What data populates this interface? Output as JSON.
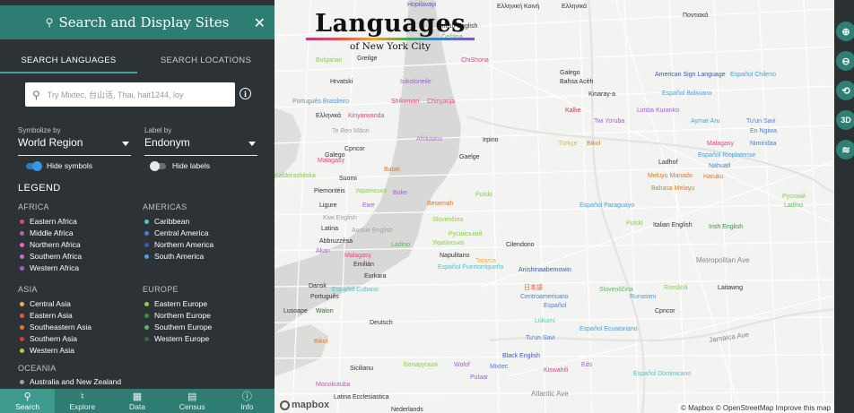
{
  "panel": {
    "title": "Search and Display Sites",
    "tabs": [
      {
        "label": "SEARCH LANGUAGES"
      },
      {
        "label": "SEARCH LOCATIONS"
      }
    ],
    "search": {
      "placeholder": "Try Mixtec, 台山话, Thai, hait1244, loy"
    },
    "symbolize": {
      "label": "Symbolize by",
      "value": "World Region"
    },
    "label_by": {
      "label": "Label by",
      "value": "Endonym"
    },
    "toggles": {
      "hide_symbols": "Hide symbols",
      "hide_labels": "Hide labels"
    },
    "legend": {
      "title": "LEGEND",
      "groups": [
        {
          "region": "AFRICA",
          "items": [
            {
              "label": "Eastern Africa",
              "color": "#e8437f"
            },
            {
              "label": "Middle Africa",
              "color": "#b85fb3"
            },
            {
              "label": "Northern Africa",
              "color": "#e86bb3"
            },
            {
              "label": "Southern Africa",
              "color": "#c06fd6"
            },
            {
              "label": "Western Africa",
              "color": "#a45ed9"
            }
          ]
        },
        {
          "region": "AMERICAS",
          "items": [
            {
              "label": "Caribbean",
              "color": "#4fc3c6"
            },
            {
              "label": "Central America",
              "color": "#4b7fd6"
            },
            {
              "label": "Northern America",
              "color": "#3959b7"
            },
            {
              "label": "South America",
              "color": "#4aa0e0"
            }
          ]
        },
        {
          "region": "ASIA",
          "items": [
            {
              "label": "Central Asia",
              "color": "#f0b33f"
            },
            {
              "label": "Eastern Asia",
              "color": "#e85a3d"
            },
            {
              "label": "Southeastern Asia",
              "color": "#e07a2a"
            },
            {
              "label": "Southern Asia",
              "color": "#d93a3a"
            },
            {
              "label": "Western Asia",
              "color": "#c9c24a"
            }
          ]
        },
        {
          "region": "EUROPE",
          "items": [
            {
              "label": "Eastern Europe",
              "color": "#88d04b"
            },
            {
              "label": "Northern Europe",
              "color": "#3d8f3d"
            },
            {
              "label": "Southern Europe",
              "color": "#5cb85c"
            },
            {
              "label": "Western Europe",
              "color": "#2f6e2f"
            }
          ]
        },
        {
          "region": "OCEANIA",
          "items": [
            {
              "label": "Australia and New Zealand",
              "color": "#9aa3a6"
            }
          ]
        }
      ]
    },
    "nav": [
      {
        "label": "Search",
        "icon": "search-icon"
      },
      {
        "label": "Explore",
        "icon": "binoculars-icon"
      },
      {
        "label": "Data",
        "icon": "table-icon"
      },
      {
        "label": "Census",
        "icon": "clipboard-icon"
      },
      {
        "label": "Info",
        "icon": "info-icon"
      }
    ]
  },
  "map": {
    "title": "Languages",
    "subtitle": "of New York City",
    "logo": "mapbox",
    "attribution": "© Mapbox © OpenStreetMap Improve this map",
    "streets": [
      "Metropolitan Ave",
      "Jamaica Ave",
      "Atlantic Ave"
    ],
    "labels": [
      {
        "text": "Hopilavayi",
        "color": "#6a4fb3"
      },
      {
        "text": "Ελληνική Κοινή",
        "color": "#333"
      },
      {
        "text": "British English",
        "color": "#333"
      },
      {
        "text": "Čeština",
        "color": "#5cb85c"
      },
      {
        "text": "Ποντιακά",
        "color": "#333"
      },
      {
        "text": "Ελληνικά",
        "color": "#333"
      },
      {
        "text": "Greilge",
        "color": "#333"
      },
      {
        "text": "Bulgarian",
        "color": "#88d04b"
      },
      {
        "text": "ChiShona",
        "color": "#e8437f"
      },
      {
        "text": "Galego",
        "color": "#333"
      },
      {
        "text": "American Sign Language",
        "color": "#3959b7"
      },
      {
        "text": "Español Chileno",
        "color": "#4aa0e0"
      },
      {
        "text": "Hrvatski",
        "color": "#333"
      },
      {
        "text": "Isikoloneile",
        "color": "#a45ed9"
      },
      {
        "text": "Bahsa Acèh",
        "color": "#333"
      },
      {
        "text": "Kinaray-a",
        "color": "#333"
      },
      {
        "text": "Español Boliviano",
        "color": "#4aa0e0"
      },
      {
        "text": "Português Brasileiro",
        "color": "#4aa0e0"
      },
      {
        "text": "Shikomori",
        "color": "#e8437f"
      },
      {
        "text": "Chinyanja",
        "color": "#e8437f"
      },
      {
        "text": "Limba Kuranko",
        "color": "#a45ed9"
      },
      {
        "text": "Kalke",
        "color": "#d93a3a"
      },
      {
        "text": "Ελληνικά",
        "color": "#333"
      },
      {
        "text": "Kinyarwanda",
        "color": "#e8437f"
      },
      {
        "text": "Twi Yoruba",
        "color": "#a45ed9"
      },
      {
        "text": "Aymar Aru",
        "color": "#4aa0e0"
      },
      {
        "text": "Tu'un Savi",
        "color": "#4b7fd6"
      },
      {
        "text": "En Ngiwa",
        "color": "#4b7fd6"
      },
      {
        "text": "Te Reo Māori",
        "color": "#9aa3a6"
      },
      {
        "text": "Afrikaans",
        "color": "#c06fd6"
      },
      {
        "text": "Irpino",
        "color": "#333"
      },
      {
        "text": "Türkçe",
        "color": "#c9c24a"
      },
      {
        "text": "Bikol",
        "color": "#e07a2a"
      },
      {
        "text": "Malagasy",
        "color": "#e8437f"
      },
      {
        "text": "Nimiridaa",
        "color": "#4b7fd6"
      },
      {
        "text": "Cpncor",
        "color": "#333"
      },
      {
        "text": "Galego",
        "color": "#333"
      },
      {
        "text": "Gaelge",
        "color": "#333"
      },
      {
        "text": "Español Rioplatense",
        "color": "#4aa0e0"
      },
      {
        "text": "Malagasy",
        "color": "#e8437f"
      },
      {
        "text": "Ladhof",
        "color": "#333"
      },
      {
        "text": "Nahuatl",
        "color": "#4b7fd6"
      },
      {
        "text": "Batak",
        "color": "#e07a2a"
      },
      {
        "text": "Kalderashitska",
        "color": "#88d04b"
      },
      {
        "text": "Suomi",
        "color": "#333"
      },
      {
        "text": "Meluyu Manado",
        "color": "#e07a2a"
      },
      {
        "text": "Haruku",
        "color": "#e07a2a"
      },
      {
        "text": "Piemontèis",
        "color": "#333"
      },
      {
        "text": "Українська",
        "color": "#88d04b"
      },
      {
        "text": "Boke",
        "color": "#a45ed9"
      },
      {
        "text": "Polski",
        "color": "#88d04b"
      },
      {
        "text": "Bahasa Melayu",
        "color": "#e07a2a"
      },
      {
        "text": "Русский",
        "color": "#88d04b"
      },
      {
        "text": "Ligure",
        "color": "#333"
      },
      {
        "text": "Ewe",
        "color": "#a45ed9"
      },
      {
        "text": "Besemah",
        "color": "#e07a2a"
      },
      {
        "text": "Español Paraguayo",
        "color": "#4aa0e0"
      },
      {
        "text": "Ladino",
        "color": "#5cb85c"
      },
      {
        "text": "Kiwi English",
        "color": "#9aa3a6"
      },
      {
        "text": "Latina",
        "color": "#333"
      },
      {
        "text": "Slovenčina",
        "color": "#88d04b"
      },
      {
        "text": "Polski",
        "color": "#88d04b"
      },
      {
        "text": "Italian English",
        "color": "#333"
      },
      {
        "text": "Irish English",
        "color": "#3d8f3d"
      },
      {
        "text": "Aussie English",
        "color": "#9aa3a6"
      },
      {
        "text": "Русинський",
        "color": "#88d04b"
      },
      {
        "text": "Abbruzzèsa",
        "color": "#333"
      },
      {
        "text": "Ladino",
        "color": "#5cb85c"
      },
      {
        "text": "Українська",
        "color": "#88d04b"
      },
      {
        "text": "Cilendono",
        "color": "#333"
      },
      {
        "text": "Akan",
        "color": "#a45ed9"
      },
      {
        "text": "Malagasy",
        "color": "#e8437f"
      },
      {
        "text": "Napulitano",
        "color": "#333"
      },
      {
        "text": "Emilián",
        "color": "#333"
      },
      {
        "text": "Tatarca",
        "color": "#f0b33f"
      },
      {
        "text": "Español Puertorriqueño",
        "color": "#4fc3c6"
      },
      {
        "text": "Eurkara",
        "color": "#333"
      },
      {
        "text": "Anishinaabemowin",
        "color": "#3959b7"
      },
      {
        "text": "Dansk",
        "color": "#333"
      },
      {
        "text": "Español Cubano",
        "color": "#4fc3c6"
      },
      {
        "text": "日本語",
        "color": "#e85a3d"
      },
      {
        "text": "Slovenščina",
        "color": "#5cb85c"
      },
      {
        "text": "Română",
        "color": "#88d04b"
      },
      {
        "text": "Laitawng",
        "color": "#333"
      },
      {
        "text": "Português",
        "color": "#333"
      },
      {
        "text": "Centroamericano",
        "color": "#4b7fd6"
      },
      {
        "text": "Español",
        "color": "#4b7fd6"
      },
      {
        "text": "Runasimi",
        "color": "#4aa0e0"
      },
      {
        "text": "Cpncor",
        "color": "#333"
      },
      {
        "text": "Lusoape",
        "color": "#333"
      },
      {
        "text": "Walon",
        "color": "#2f6e2f"
      },
      {
        "text": "Deutsch",
        "color": "#333"
      },
      {
        "text": "Lùkumí",
        "color": "#4fc3c6"
      },
      {
        "text": "Español Ecuatoriano",
        "color": "#4aa0e0"
      },
      {
        "text": "Tu'un Savi",
        "color": "#4b7fd6"
      },
      {
        "text": "Bikol",
        "color": "#e07a2a"
      },
      {
        "text": "Black English",
        "color": "#3959b7"
      },
      {
        "text": "Sicilianu",
        "color": "#333"
      },
      {
        "text": "Беларуская",
        "color": "#88d04b"
      },
      {
        "text": "Wolof",
        "color": "#a45ed9"
      },
      {
        "text": "Mixtec",
        "color": "#4b7fd6"
      },
      {
        "text": "Kiswahili",
        "color": "#e8437f"
      },
      {
        "text": "Eds",
        "color": "#a45ed9"
      },
      {
        "text": "Español Dominicano",
        "color": "#4fc3c6"
      },
      {
        "text": "Monokutuba",
        "color": "#b85fb3"
      },
      {
        "text": "Pulaar",
        "color": "#a45ed9"
      },
      {
        "text": "Latina Ecclesiastica",
        "color": "#333"
      },
      {
        "text": "Nederlands",
        "color": "#333"
      }
    ]
  }
}
